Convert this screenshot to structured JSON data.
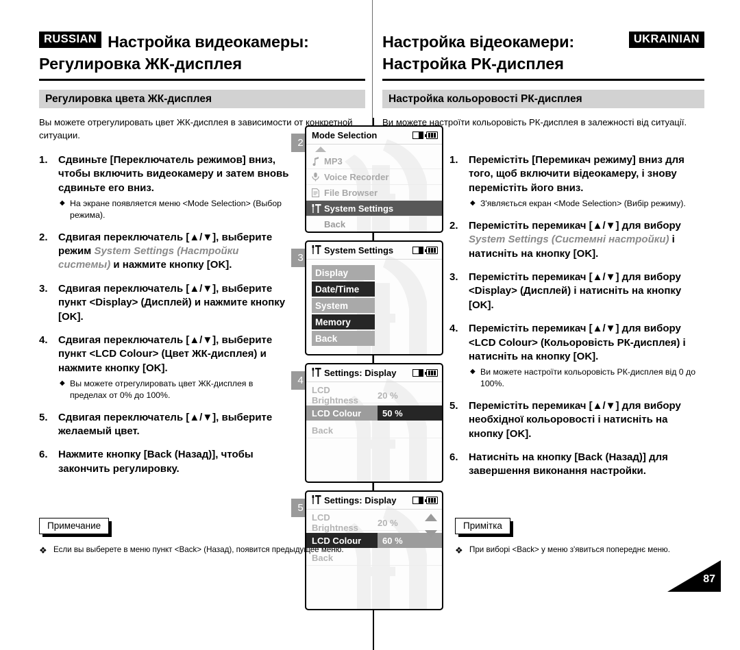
{
  "header": {
    "russian": {
      "lang_tag": "RUSSIAN",
      "title_line1": "Настройка видеокамеры:",
      "title_line2": "Регулировка ЖК-дисплея",
      "section_bar": "Регулировка цвета ЖК-дисплея"
    },
    "ukrainian": {
      "lang_tag": "UKRAINIAN",
      "title_line1": "Настройка відеокамери:",
      "title_line2": "Настройка РК-дисплея",
      "section_bar": "Настройка кольоровості РК-дисплея"
    }
  },
  "russian": {
    "intro": "Вы можете отрегулировать цвет ЖК-дисплея в зависимости от конкретной ситуации.",
    "steps": [
      {
        "num": "1.",
        "text": "Сдвиньте [Переключатель режимов] вниз, чтобы включить видеокамеру и затем вновь сдвиньте его вниз.",
        "subs": [
          "На экране появляется меню <Mode Selection> (Выбор режима)."
        ]
      },
      {
        "num": "2.",
        "text_pre": "Сдвигая переключатель [▲/▼], выберите режим ",
        "text_italic": "System Settings (Настройки системы)",
        "text_post": " и нажмите кнопку [OK].",
        "subs": []
      },
      {
        "num": "3.",
        "text": "Сдвигая переключатель [▲/▼], выберите пункт <Display> (Дисплей) и нажмите кнопку [OK].",
        "subs": []
      },
      {
        "num": "4.",
        "text": "Сдвигая переключатель [▲/▼], выберите пункт <LCD Colour> (Цвет ЖК-дисплея) и нажмите кнопку [OK].",
        "subs": [
          "Вы можете отрегулировать цвет ЖК-дисплея в пределах от 0% до 100%."
        ]
      },
      {
        "num": "5.",
        "text": "Сдвигая переключатель [▲/▼], выберите желаемый цвет.",
        "subs": []
      },
      {
        "num": "6.",
        "text": "Нажмите кнопку [Back (Назад)], чтобы закончить регулировку.",
        "subs": []
      }
    ],
    "note": {
      "label": "Примечание",
      "mark": "❖",
      "text": "Если вы выберете в меню пункт <Back> (Назад), появится предыдущее меню."
    }
  },
  "ukrainian": {
    "intro": "Ви можете настроїти кольоровість РК-дисплея в залежності від ситуації.",
    "steps": [
      {
        "num": "1.",
        "text": "Перемістіть [Перемикач режиму] вниз для того, щоб включити відеокамеру, і знову перемістіть його вниз.",
        "subs": [
          "З'являється екран <Mode Selection> (Вибір режиму)."
        ]
      },
      {
        "num": "2.",
        "text_pre": "Перемістіть перемикач [▲/▼] для вибору ",
        "text_italic": "System Settings (Системні настройки)",
        "text_post": " і натисніть на кнопку [OK].",
        "subs": []
      },
      {
        "num": "3.",
        "text": "Перемістіть перемикач [▲/▼] для вибору <Display> (Дисплей) і натисніть на кнопку [OK].",
        "subs": []
      },
      {
        "num": "4.",
        "text": "Перемістіть перемикач [▲/▼] для вибору <LCD Colour> (Кольоровість РК-дисплея) і натисніть на кнопку [OK].",
        "subs": [
          "Ви можете настроїти кольоровість РК-дисплея від 0 до 100%."
        ]
      },
      {
        "num": "5.",
        "text": "Перемістіть перемикач [▲/▼] для вибору необхідної кольоровості і натисніть на кнопку [OK].",
        "subs": []
      },
      {
        "num": "6.",
        "text": "Натисніть на кнопку [Back (Назад)] для завершення виконання настройки.",
        "subs": []
      }
    ],
    "note": {
      "label": "Примітка",
      "mark": "❖",
      "text": "При виборі <Back> у меню з'явиться попереднє меню."
    }
  },
  "screens": [
    {
      "badge": "2",
      "title": "Mode Selection",
      "title_icon": "",
      "icons": [
        "memory-card-icon",
        "battery-icon"
      ],
      "items": [
        {
          "label": "MP3",
          "icon": "music-note-icon",
          "state": "normal"
        },
        {
          "label": "Voice Recorder",
          "icon": "microphone-icon",
          "state": "normal"
        },
        {
          "label": "File Browser",
          "icon": "file-icon",
          "state": "normal"
        },
        {
          "label": "System Settings",
          "icon": "tools-icon",
          "state": "selected"
        },
        {
          "label": "Back",
          "icon": "",
          "state": "plain"
        }
      ]
    },
    {
      "badge": "3",
      "title": "System Settings",
      "title_icon": "tools-icon",
      "icons": [
        "memory-card-icon",
        "battery-icon"
      ],
      "items": [
        {
          "label": "Display",
          "state": "gray"
        },
        {
          "label": "Date/Time",
          "state": "dark"
        },
        {
          "label": "System",
          "state": "gray"
        },
        {
          "label": "Memory",
          "state": "dark"
        },
        {
          "label": "Back",
          "state": "gray"
        }
      ]
    },
    {
      "badge": "4",
      "title": "Settings: Display",
      "title_icon": "tools-icon",
      "icons": [
        "memory-card-icon",
        "battery-icon"
      ],
      "rows": [
        {
          "label": "LCD Brightness",
          "value": "20 %",
          "state": "normal"
        },
        {
          "label": "LCD Colour",
          "value": "50 %",
          "state": "highlight"
        },
        {
          "label": "Back",
          "value": "",
          "state": "back"
        }
      ],
      "scroll_arrows": false
    },
    {
      "badge": "5",
      "title": "Settings: Display",
      "title_icon": "tools-icon",
      "icons": [
        "memory-card-icon",
        "battery-icon"
      ],
      "rows": [
        {
          "label": "LCD Brightness",
          "value": "20 %",
          "state": "normal"
        },
        {
          "label": "LCD Colour",
          "value": "60 %",
          "state": "highlight2"
        },
        {
          "label": "Back",
          "value": "",
          "state": "back"
        }
      ],
      "scroll_arrows": true
    }
  ],
  "page_number": "87",
  "colors": {
    "section_bar_bg": "#d2d2d2",
    "badge_bg": "#9a9a9a",
    "selected_row_bg": "#585858",
    "dark_row_bg": "#262626",
    "gray_row_bg": "#a9a9a9"
  }
}
